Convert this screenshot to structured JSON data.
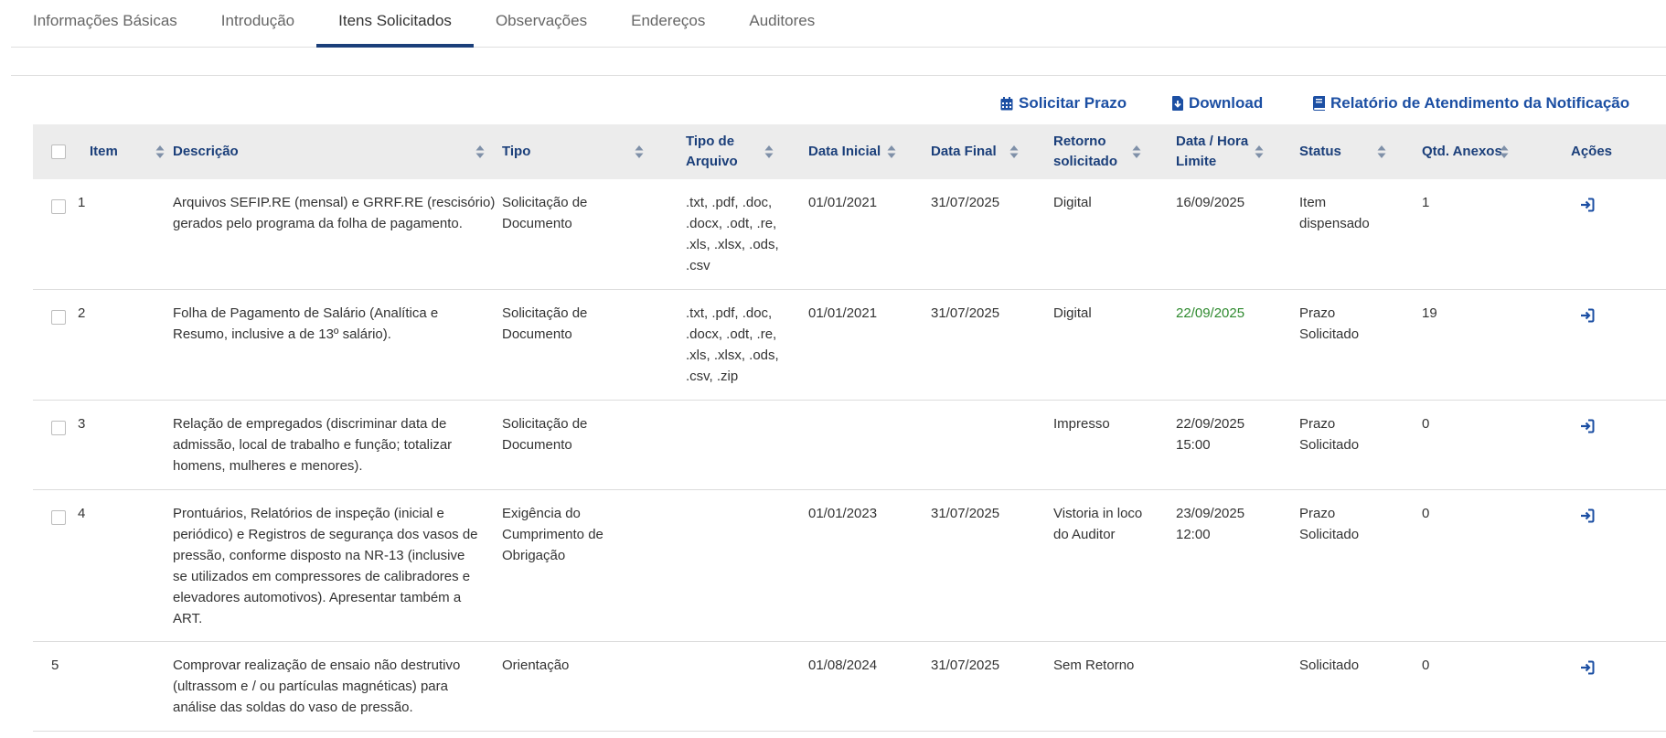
{
  "tabs": [
    "Informações Básicas",
    "Introdução",
    "Itens Solicitados",
    "Observações",
    "Endereços",
    "Auditores"
  ],
  "active_tab": "Itens Solicitados",
  "actions": {
    "solicitar_prazo": "Solicitar Prazo",
    "download": "Download",
    "relatorio": "Relatório de Atendimento da Notificação"
  },
  "columns": {
    "item": "Item",
    "descricao": "Descrição",
    "tipo": "Tipo",
    "tipo_arquivo_l1": "Tipo de",
    "tipo_arquivo_l2": "Arquivo",
    "data_inicial": "Data Inicial",
    "data_final": "Data Final",
    "retorno_l1": "Retorno",
    "retorno_l2": "solicitado",
    "limite_l1": "Data / Hora",
    "limite_l2": "Limite",
    "status": "Status",
    "anexos": "Qtd. Anexos",
    "acoes": "Ações"
  },
  "rows": [
    {
      "item": "1",
      "descricao": [
        "Arquivos SEFIP.RE (mensal) e GRRF.RE (rescisório)",
        "gerados pelo programa da folha de pagamento."
      ],
      "tipo": [
        "Solicitação de",
        "Documento"
      ],
      "arquivo": [
        ".txt, .pdf, .doc,",
        ".docx, .odt, .re,",
        ".xls, .xlsx, .ods,",
        ".csv"
      ],
      "data_inicial": "01/01/2021",
      "data_final": "31/07/2025",
      "retorno": [
        "Digital"
      ],
      "limite": [
        "16/09/2025"
      ],
      "status": [
        "Item",
        "dispensado"
      ],
      "anexos": "1"
    },
    {
      "item": "2",
      "descricao": [
        "Folha de Pagamento de Salário (Analítica e",
        "Resumo, inclusive a de 13º salário)."
      ],
      "tipo": [
        "Solicitação de",
        "Documento"
      ],
      "arquivo": [
        ".txt, .pdf, .doc,",
        ".docx, .odt, .re,",
        ".xls, .xlsx, .ods,",
        ".csv, .zip"
      ],
      "data_inicial": "01/01/2021",
      "data_final": "31/07/2025",
      "retorno": [
        "Digital"
      ],
      "limite": [
        "22/09/2025"
      ],
      "limite_color": "#2f8a2f",
      "status": [
        "Prazo",
        "Solicitado"
      ],
      "anexos": "19"
    },
    {
      "item": "3",
      "descricao": [
        "Relação de empregados (discriminar data de",
        "admissão, local de trabalho e função; totalizar",
        "homens, mulheres e menores)."
      ],
      "tipo": [
        "Solicitação de",
        "Documento"
      ],
      "arquivo": [],
      "data_inicial": "",
      "data_final": "",
      "retorno": [
        "Impresso"
      ],
      "limite": [
        "22/09/2025",
        "15:00"
      ],
      "status": [
        "Prazo",
        "Solicitado"
      ],
      "anexos": "0"
    },
    {
      "item": "4",
      "descricao": [
        "Prontuários, Relatórios de inspeção (inicial e",
        "periódico) e Registros de segurança dos vasos de",
        "pressão, conforme disposto na NR-13 (inclusive",
        "se utilizados em compressores de calibradores e",
        "elevadores automotivos). Apresentar também a",
        "ART."
      ],
      "tipo": [
        "Exigência do",
        "Cumprimento de",
        "Obrigação"
      ],
      "arquivo": [],
      "data_inicial": "01/01/2023",
      "data_final": "31/07/2025",
      "retorno": [
        "Vistoria in loco",
        "do Auditor"
      ],
      "limite": [
        "23/09/2025",
        "12:00"
      ],
      "status": [
        "Prazo",
        "Solicitado"
      ],
      "anexos": "0"
    },
    {
      "item": "5",
      "descricao": [
        "Comprovar realização de ensaio não destrutivo",
        "(ultrassom e / ou partículas magnéticas) para",
        "análise das soldas do vaso de pressão."
      ],
      "tipo": [
        "Orientação"
      ],
      "arquivo": [],
      "data_inicial": "01/08/2024",
      "data_final": "31/07/2025",
      "retorno": [
        "Sem Retorno"
      ],
      "limite": [],
      "status": [
        "Solicitado"
      ],
      "anexos": "0",
      "no_checkbox": true
    }
  ],
  "colors": {
    "primary": "#1b3f7a",
    "link": "#1c4fa3",
    "header_bg": "#ececec",
    "green": "#2f8a2f"
  },
  "icons": {
    "solicitar_prazo": "calendar-icon",
    "download": "file-download-icon",
    "relatorio": "book-icon",
    "sort": "sort-icon",
    "acao": "sign-in-arrow-icon"
  }
}
